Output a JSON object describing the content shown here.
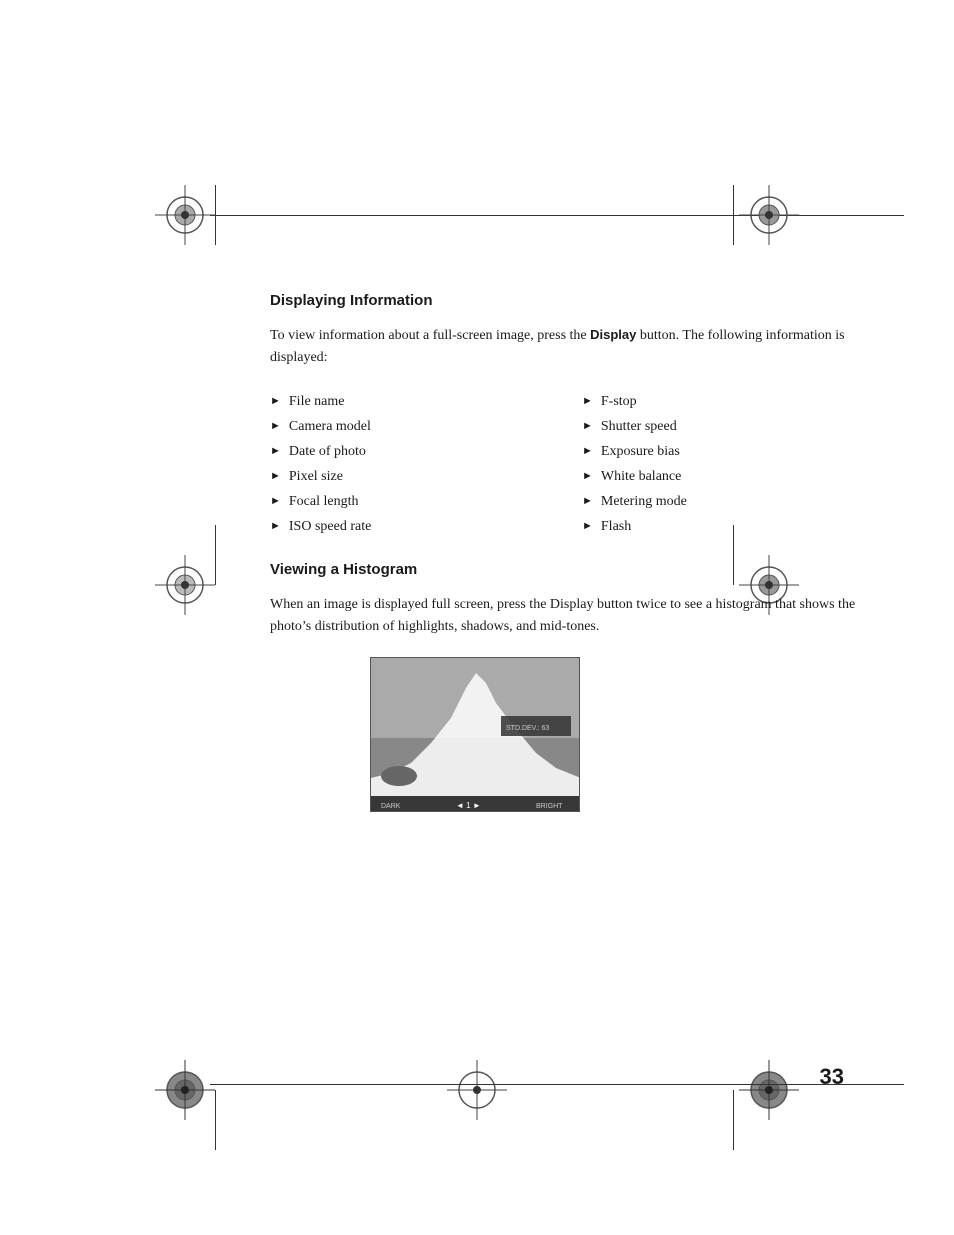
{
  "page": {
    "number": "33",
    "sections": [
      {
        "id": "displaying-information",
        "title": "Displaying Information",
        "intro": "To view information about a full-screen image, press the",
        "intro_keyword": "Display",
        "intro_cont": " button. The following information is displayed:",
        "bullets_left": [
          "File name",
          "Camera model",
          "Date of photo",
          "Pixel size",
          "Focal length",
          "ISO speed rate"
        ],
        "bullets_right": [
          "F-stop",
          "Shutter speed",
          "Exposure bias",
          "White balance",
          "Metering mode",
          "Flash"
        ]
      },
      {
        "id": "viewing-histogram",
        "title": "Viewing a Histogram",
        "body1": "When an image is displayed full screen, press the",
        "body_keyword": "Display",
        "body2": " button twice to see a histogram that shows the photo’s distribution of highlights, shadows, and mid-tones."
      }
    ]
  }
}
